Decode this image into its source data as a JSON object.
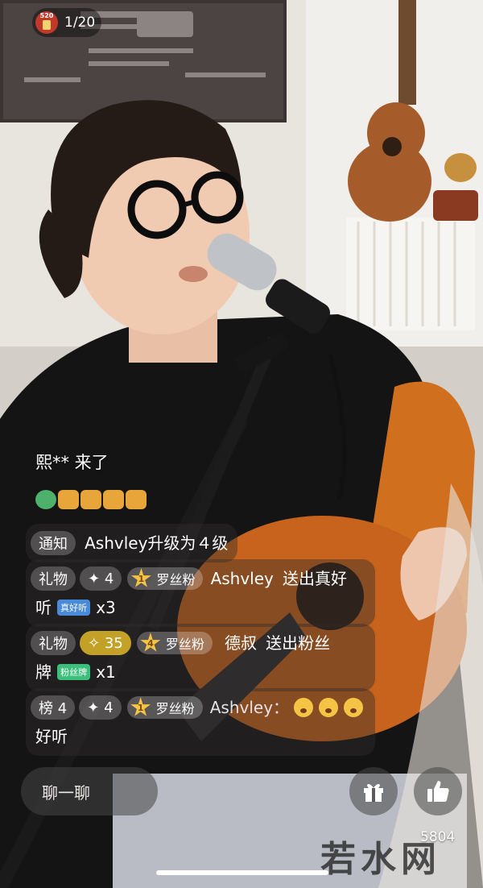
{
  "header": {
    "viewer_count": "1/20",
    "badge_text": "520"
  },
  "chat": {
    "entry": "熙** 来了",
    "notice": {
      "tag": "通知",
      "text": "Ashvley升级为４级"
    },
    "gift1": {
      "tag": "礼物",
      "level": "4",
      "fan_label": "罗丝粉",
      "fan_level": "1",
      "name": "Ashvley",
      "action_line1": "送出真好",
      "action_line2": "听",
      "gift_icon_text": "真好听",
      "count": "x3"
    },
    "gift2": {
      "tag": "礼物",
      "level": "35",
      "fan_label": "罗丝粉",
      "fan_level": "4",
      "name": "德叔",
      "action_line1": "送出粉丝",
      "action_line2": "牌",
      "gift_icon_text": "粉丝牌",
      "count": "x1"
    },
    "rank": {
      "tag": "榜 4",
      "level": "4",
      "fan_label": "罗丝粉",
      "fan_level": "1",
      "name": "Ashvley：",
      "text": "好听"
    }
  },
  "bottom": {
    "input_placeholder": "聊一聊",
    "like_count": "5804"
  },
  "watermark": "若水网",
  "icons": {
    "gift": "gift-icon",
    "like": "thumbs-up-icon"
  }
}
